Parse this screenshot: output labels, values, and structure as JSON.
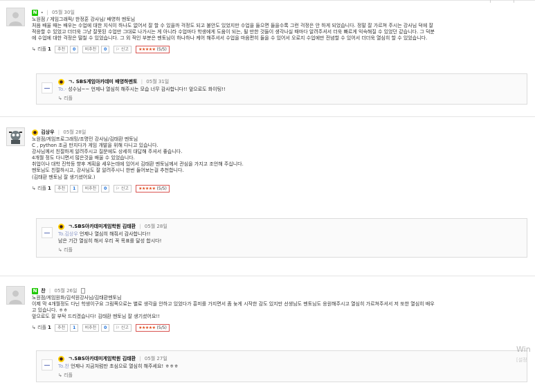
{
  "comments": [
    {
      "author": "-",
      "date": "05월 30일",
      "lines": [
        "노원점 / 게임그래픽/ 한정훈 강사님/ 배영하 멘토님",
        "처음 배울 때는 배우는 수업에 대한 지식이 하나도 없어서 잘 할 수 있을까 걱정도 되고 불안도 있었지만 수업을 들으면 들을수록 그런 걱정은 안 하게 되었습니다. 정말 잘 가르쳐 주시는 강사님 덕에 잘",
        "적응할 수 있었고 더더욱 그냥 잘못된 수업만 그대로 나가시는 게 아니라 수업마다 학생에게 도움이 되는, 될 만한 것들이 생각나실 때마다 알려주셔서 더욱 빠르게 익숙해질 수 있었던 같습니다. 그 덕분",
        "에 수업에 대한 걱정은 떨칠 수 있었습니다. 그 외 적인 부분은 멘토님이 하나하나 케어 해주셔서 수업을 마음편히 들을 수 있어서 오로지 수업에만 전념할 수 있어서 더더욱 열심히 할 수 있었습니다."
      ],
      "reply_label": "리플",
      "reply_count": "1",
      "recommend_label": "추천",
      "recommend_count": "0",
      "notrecommend_label": "비추천",
      "notrecommend_count": "0",
      "report_label": "신고",
      "stars": "★★★★★",
      "score": "(5/5)",
      "reply": {
        "author": "ㄱ. SBS게임아카데미 배영하멘토",
        "date": "05월 31일",
        "to": "To.-",
        "text": " 성수님~~ 언제나 열심히 해주시는 모습 너무 감사합니다!! 앞으로도 화이팅!!",
        "reply_label": "리플"
      }
    },
    {
      "author": "김상우",
      "date": "05월 28일",
      "lines": [
        "노원점/게임프로그래밍/조명민 강사님/김태환 멘토님",
        "C , python 조금 만지다가 게임 개발을 위해 다니고 있습니다.",
        "강사님께서 친절하게 알려주시고 질문에도 상세히 대답해 주셔서 좋습니다.",
        "4개월 정도 다니면서 많은것을 배울 수 있었습니다.",
        "취업이나 대학 진학등 향후 계획을 세우는데에 있어서 김태환 멘토님께서 관심을 가지고 조언해 주십니다.",
        "멘토님도 친절하시고, 강사님도 잘 알려주시니 한번 들어보는걸 추천합니다.",
        "(김태환 멘토님 잘 생기셨어요.)"
      ],
      "reply_label": "리플",
      "reply_count": "1",
      "recommend_label": "추천",
      "recommend_count": "1",
      "notrecommend_label": "비추천",
      "notrecommend_count": "0",
      "report_label": "신고",
      "stars": "★★★★★",
      "score": "(5/5)",
      "reply": {
        "author": "ㄱ.SBS아카데미게임학원 김태환",
        "date": "05월 28일",
        "to": "To.김상우",
        "text": "  언제나 열심히 해줘서 감사합니다!!",
        "text2": "남은 기간 열심히 해서 우리 꼭 목표를 달성 합시다!",
        "reply_label": "리플"
      }
    },
    {
      "author": "찬",
      "date": "05월 26일",
      "lines": [
        "노원점/게임원화/김석원강사님/김태환멘토님",
        "이제 막 4개월정도 다닌 학생이구요 그림쪽으로는 별로 생각을 안하고 있었다가 흥미를 가지면서 좀 늦게 시작한 감도 있지만 선생님도 멘토님도 응원해주시고 열심히 가르쳐주셔서 저 또한 열심히 배우",
        "고 있습니다. ㅎㅎ",
        "앞으로도 잘 부탁 드리겠습니다! 김태환 멘토님 잘 생기셨어요!!"
      ],
      "reply_label": "리플",
      "reply_count": "1",
      "recommend_label": "추천",
      "recommend_count": "1",
      "notrecommend_label": "비추천",
      "notrecommend_count": "0",
      "report_label": "신고",
      "stars": "★★★★★",
      "score": "(5/5)",
      "reply": {
        "author": "ㄱ.SBS아카데미게임학원 김태환",
        "date": "05월 27일",
        "to": "To.찬",
        "text": "  언제나 지금처럼만 초심으로 열심히 해주세요! ㅎㅎㅎ",
        "reply_label": "리플"
      }
    }
  ],
  "watermark": {
    "line1": "Win",
    "line2": "[설정"
  }
}
